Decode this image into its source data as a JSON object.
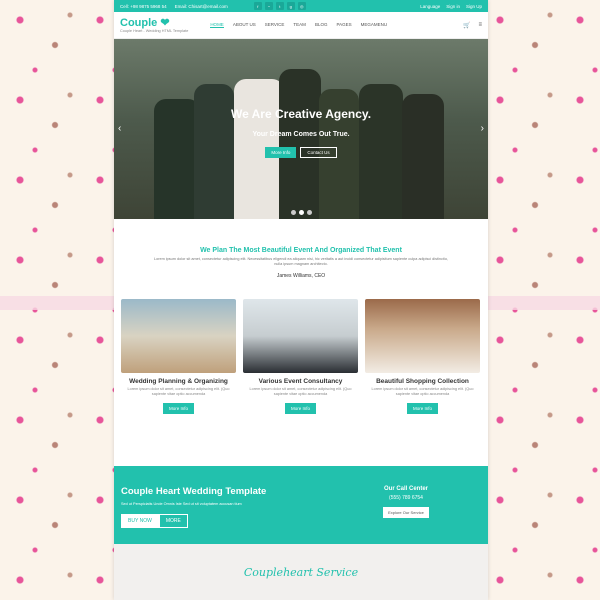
{
  "topbar": {
    "phone": "Cell: +98 9875 5968 54",
    "email": "Email: Chisart@email.com",
    "language": "Language",
    "signin": "Sign in",
    "signup": "Sign Up"
  },
  "brand": {
    "name": "Couple",
    "tagline": "Couple Heart - Wedding HTML Template"
  },
  "nav": {
    "items": [
      "HOME",
      "ABOUT US",
      "SERVICE",
      "TEAM",
      "BLOG",
      "PAGES",
      "MEGAMENU"
    ]
  },
  "hero": {
    "title": "We Are Creative Agency.",
    "subtitle": "Your Dream Comes Out True.",
    "more": "More Info",
    "contact": "Contact Us"
  },
  "intro": {
    "heading": "We Plan The Most Beautiful Event And Organized That Event",
    "text": "Lorem ipsum dolor sit amet, consectetur adipiscing elit. Necessitatibus eligendi ea aliquam nisi, hic veritatis a aut incidi consectetur adipisitum sapiente culpa adipisci distinctio, nulla ipsum magnam architecto.",
    "ceo": "James Williams, CEO"
  },
  "cards": [
    {
      "title": "Wedding Planning & Organizing",
      "text": "Lorem ipsum dolor sit amet, consectetur adipiscing elit. (Quo sapiente vitae optio accumenda",
      "btn": "More Info"
    },
    {
      "title": "Various Event Consultancy",
      "text": "Lorem ipsum dolor sit amet, consectetur adipiscing elit. (Quo sapiente vitae optio accumenda",
      "btn": "More Info"
    },
    {
      "title": "Beautiful Shopping Collection",
      "text": "Lorem ipsum dolor sit amet, consectetur adipiscing elit. (Quo sapiente vitae optio accumenda",
      "btn": "More Info"
    }
  ],
  "cta": {
    "title": "Couple Heart Wedding Template",
    "desc": "Sed ut Perspiciatis Unde Omnis Iste Sed ut sit voluptatem accusan tium",
    "buy": "BUY NOW",
    "more": "MORE",
    "call_head": "Our Call Center",
    "call_num": "(555) 789 6754",
    "explore": "Explore Our Service"
  },
  "service": {
    "title": "Coupleheart Service"
  }
}
